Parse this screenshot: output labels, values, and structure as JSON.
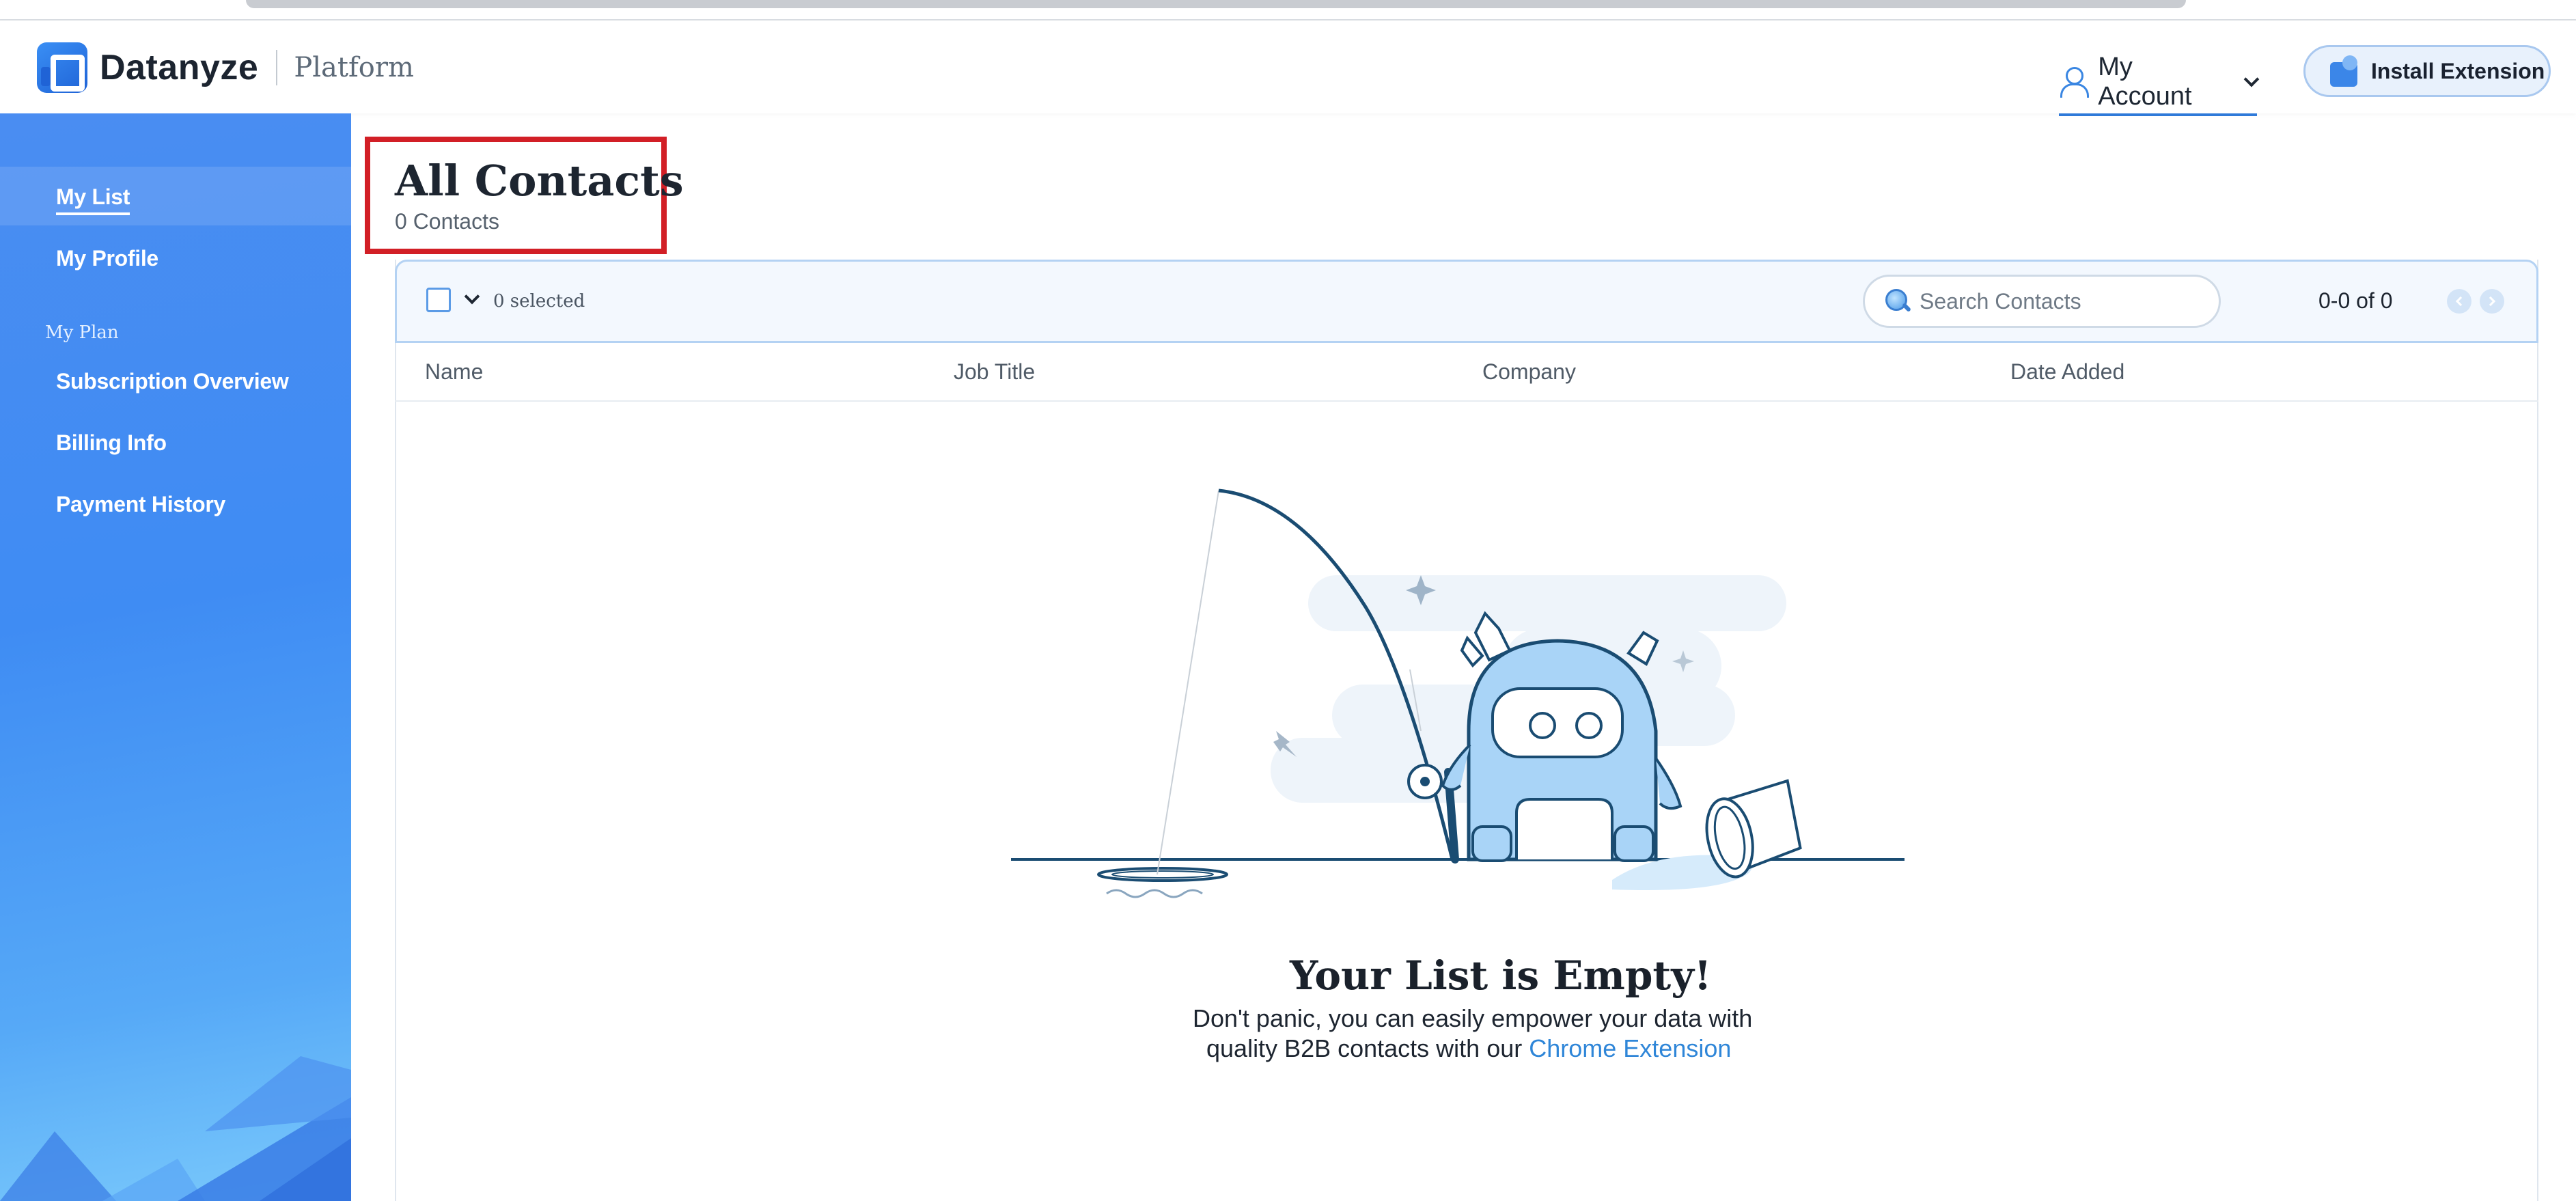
{
  "header": {
    "brand_name": "Datanyze",
    "product_name": "Platform",
    "account_label": "My Account",
    "install_label": "Install Extension"
  },
  "sidebar": {
    "items": [
      {
        "label": "My List",
        "active": true
      },
      {
        "label": "My Profile"
      }
    ],
    "section_label": "My Plan",
    "plan_items": [
      {
        "label": "Subscription Overview"
      },
      {
        "label": "Billing Info"
      },
      {
        "label": "Payment History"
      }
    ]
  },
  "main": {
    "title": "All Contacts",
    "subtitle": "0 Contacts",
    "toolbar": {
      "selected_text": "0 selected",
      "search_placeholder": "Search Contacts",
      "pagination": "0-0 of 0"
    },
    "columns": [
      "Name",
      "Job Title",
      "Company",
      "Date Added"
    ],
    "empty": {
      "title": "Your List is Empty!",
      "line1": "Don't panic, you can easily empower your data with",
      "line2_prefix": "quality B2B contacts with our",
      "link": "Chrome Extension"
    }
  },
  "colors": {
    "accent": "#2f86d8",
    "highlight_border": "#d21f26",
    "sidebar_top": "#4a8df2",
    "sidebar_bottom": "#7ac9fb"
  }
}
